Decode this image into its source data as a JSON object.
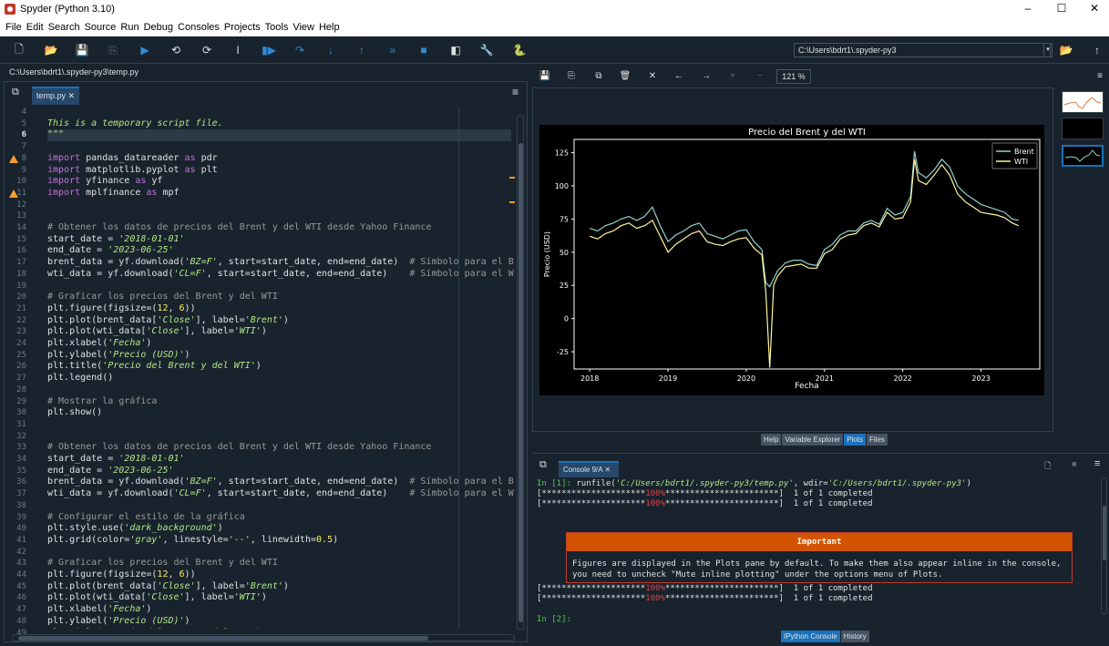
{
  "window": {
    "title": "Spyder (Python 3.10)",
    "minimize": "–",
    "maximize": "☐",
    "close": "✕"
  },
  "menu": [
    "File",
    "Edit",
    "Search",
    "Source",
    "Run",
    "Debug",
    "Consoles",
    "Projects",
    "Tools",
    "View",
    "Help"
  ],
  "toolbar": {
    "working_dir": "C:\\Users\\bdrt1\\.spyder-py3",
    "dropdown": "▾"
  },
  "editor": {
    "path": "C:\\Users\\bdrt1\\.spyder-py3\\temp.py",
    "tab": "temp.py ✕",
    "lines": [
      {
        "n": "4",
        "t": ""
      },
      {
        "n": "5",
        "t": "This is a temporary script file.",
        "c": "st it"
      },
      {
        "n": "6",
        "t": "\"\"\"",
        "c": "st",
        "cur": true
      },
      {
        "n": "7",
        "t": ""
      },
      {
        "n": "8",
        "t": "import pandas_datareader as pdr",
        "w": true
      },
      {
        "n": "9",
        "t": "import matplotlib.pyplot as plt"
      },
      {
        "n": "10",
        "t": "import yfinance as yf"
      },
      {
        "n": "11",
        "t": "import mplfinance as mpf",
        "w": true
      },
      {
        "n": "12",
        "t": ""
      },
      {
        "n": "13",
        "t": ""
      },
      {
        "n": "14",
        "t": "# Obtener los datos de precios del Brent y del WTI desde Yahoo Finance",
        "c": "cm"
      },
      {
        "n": "15",
        "t": "start_date = '2018-01-01'"
      },
      {
        "n": "16",
        "t": "end_date = '2023-06-25'"
      },
      {
        "n": "17",
        "t": "brent_data = yf.download('BZ=F', start=start_date, end=end_date)  # Símbolo para el Brent"
      },
      {
        "n": "18",
        "t": "wti_data = yf.download('CL=F', start=start_date, end=end_date)    # Símbolo para el WTI e"
      },
      {
        "n": "19",
        "t": ""
      },
      {
        "n": "20",
        "t": "# Graficar los precios del Brent y del WTI",
        "c": "cm"
      },
      {
        "n": "21",
        "t": "plt.figure(figsize=(12, 6))"
      },
      {
        "n": "22",
        "t": "plt.plot(brent_data['Close'], label='Brent')"
      },
      {
        "n": "23",
        "t": "plt.plot(wti_data['Close'], label='WTI')"
      },
      {
        "n": "24",
        "t": "plt.xlabel('Fecha')"
      },
      {
        "n": "25",
        "t": "plt.ylabel('Precio (USD)')"
      },
      {
        "n": "26",
        "t": "plt.title('Precio del Brent y del WTI')"
      },
      {
        "n": "27",
        "t": "plt.legend()"
      },
      {
        "n": "28",
        "t": ""
      },
      {
        "n": "29",
        "t": "# Mostrar la gráfica",
        "c": "cm"
      },
      {
        "n": "30",
        "t": "plt.show()"
      },
      {
        "n": "31",
        "t": ""
      },
      {
        "n": "32",
        "t": ""
      },
      {
        "n": "33",
        "t": "# Obtener los datos de precios del Brent y del WTI desde Yahoo Finance",
        "c": "cm"
      },
      {
        "n": "34",
        "t": "start_date = '2018-01-01'"
      },
      {
        "n": "35",
        "t": "end_date = '2023-06-25'"
      },
      {
        "n": "36",
        "t": "brent_data = yf.download('BZ=F', start=start_date, end=end_date)  # Símbolo para el Brent"
      },
      {
        "n": "37",
        "t": "wti_data = yf.download('CL=F', start=start_date, end=end_date)    # Símbolo para el WTI e"
      },
      {
        "n": "38",
        "t": ""
      },
      {
        "n": "39",
        "t": "# Configurar el estilo de la gráfica",
        "c": "cm"
      },
      {
        "n": "40",
        "t": "plt.style.use('dark_background')"
      },
      {
        "n": "41",
        "t": "plt.grid(color='gray', linestyle='--', linewidth=0.5)"
      },
      {
        "n": "42",
        "t": ""
      },
      {
        "n": "43",
        "t": "# Graficar los precios del Brent y del WTI",
        "c": "cm"
      },
      {
        "n": "44",
        "t": "plt.figure(figsize=(12, 6))"
      },
      {
        "n": "45",
        "t": "plt.plot(brent_data['Close'], label='Brent')"
      },
      {
        "n": "46",
        "t": "plt.plot(wti_data['Close'], label='WTI')"
      },
      {
        "n": "47",
        "t": "plt.xlabel('Fecha')"
      },
      {
        "n": "48",
        "t": "plt.ylabel('Precio (USD)')"
      },
      {
        "n": "49",
        "t": "plt.title('Precio del Brent y del WTI')"
      }
    ]
  },
  "plots": {
    "zoom": "121 %"
  },
  "chart_data": {
    "type": "line",
    "title": "Precio del Brent y del WTI",
    "xlabel": "Fecha",
    "ylabel": "Precio (USD)",
    "x_ticks": [
      "2018",
      "2019",
      "2020",
      "2021",
      "2022",
      "2023"
    ],
    "y_ticks": [
      -25,
      0,
      25,
      50,
      75,
      100,
      125
    ],
    "xlim": [
      2017.8,
      2023.75
    ],
    "ylim": [
      -38,
      135
    ],
    "x": [
      2018.0,
      2018.1,
      2018.2,
      2018.3,
      2018.4,
      2018.5,
      2018.6,
      2018.7,
      2018.8,
      2018.9,
      2019.0,
      2019.1,
      2019.2,
      2019.3,
      2019.4,
      2019.5,
      2019.6,
      2019.7,
      2019.8,
      2019.9,
      2020.0,
      2020.1,
      2020.2,
      2020.25,
      2020.3,
      2020.35,
      2020.4,
      2020.5,
      2020.6,
      2020.7,
      2020.8,
      2020.9,
      2021.0,
      2021.1,
      2021.2,
      2021.3,
      2021.4,
      2021.5,
      2021.6,
      2021.7,
      2021.8,
      2021.9,
      2022.0,
      2022.1,
      2022.15,
      2022.2,
      2022.3,
      2022.4,
      2022.5,
      2022.6,
      2022.7,
      2022.8,
      2022.9,
      2023.0,
      2023.1,
      2023.2,
      2023.3,
      2023.4,
      2023.48
    ],
    "series": [
      {
        "name": "Brent",
        "color": "#8ed3cf",
        "values": [
          68,
          66,
          70,
          72,
          75,
          77,
          74,
          77,
          84,
          70,
          58,
          63,
          66,
          70,
          72,
          64,
          62,
          60,
          63,
          66,
          67,
          58,
          52,
          27,
          24,
          30,
          36,
          42,
          44,
          44,
          41,
          40,
          52,
          56,
          63,
          66,
          66,
          72,
          74,
          71,
          83,
          78,
          80,
          92,
          126,
          110,
          106,
          112,
          120,
          114,
          100,
          94,
          90,
          86,
          84,
          82,
          80,
          75,
          74
        ]
      },
      {
        "name": "WTI",
        "color": "#fff59d",
        "values": [
          62,
          60,
          64,
          66,
          70,
          72,
          68,
          70,
          74,
          62,
          50,
          56,
          60,
          64,
          66,
          58,
          56,
          55,
          58,
          60,
          61,
          53,
          48,
          20,
          -37,
          25,
          32,
          39,
          40,
          41,
          38,
          38,
          49,
          52,
          60,
          63,
          64,
          70,
          72,
          69,
          80,
          75,
          76,
          88,
          120,
          104,
          101,
          108,
          116,
          108,
          94,
          88,
          84,
          80,
          79,
          78,
          76,
          72,
          70
        ]
      }
    ],
    "legend": {
      "position": "top-right",
      "entries": [
        "Brent",
        "WTI"
      ]
    }
  },
  "tabs_top": [
    "Help",
    "Variable Explorer",
    "Plots",
    "Files"
  ],
  "console": {
    "tab": "Console 9/A ✕",
    "prompt1": "In [1]:",
    "cmd1": " runfile(",
    "cmd1_arg1": "'C:/Users/bdrt1/.spyder-py3/temp.py'",
    "cmd1_mid": ", wdir=",
    "cmd1_arg2": "'C:/Users/bdrt1/.spyder-py3'",
    "cmd1_end": ")",
    "prog_a": "[*********************",
    "prog_b": "100%",
    "prog_c": "***********************]  1 of 1 completed",
    "important_title": "Important",
    "important_body": "Figures are displayed in the Plots pane by default. To make them also appear inline in the console, you need to uncheck \"Mute inline plotting\" under the options menu of Plots.",
    "prompt2": "In [2]:"
  },
  "tabs_bottom": [
    "IPython Console",
    "History"
  ]
}
